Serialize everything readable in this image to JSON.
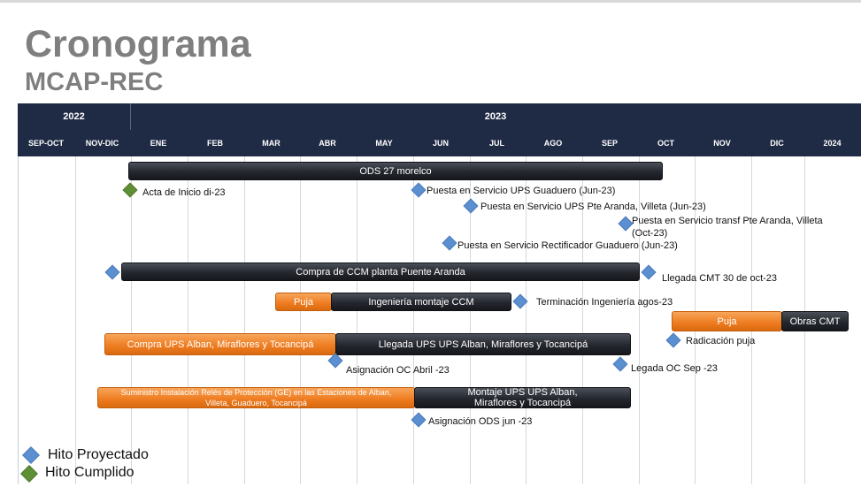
{
  "header": {
    "title": "Cronograma",
    "subtitle": "MCAP-REC"
  },
  "years": [
    "2022",
    "2023"
  ],
  "months": [
    "SEP-OCT",
    "NOV-DIC",
    "ENE",
    "FEB",
    "MAR",
    "ABR",
    "MAY",
    "JUN",
    "JUL",
    "AGO",
    "SEP",
    "OCT",
    "NOV",
    "DIC",
    "2024"
  ],
  "bars": {
    "ods": "ODS 27 morelco",
    "ccm": "Compra de CCM planta Puente Aranda",
    "puja1": "Puja",
    "ing_ccm": "Ingeniería montaje CCM",
    "puja2": "Puja",
    "obras": "Obras CMT",
    "compra_ups": "Compra UPS Alban, Miraflores y Tocancipá",
    "llegada_ups": "Llegada UPS UPS Alban, Miraflores y Tocancipá",
    "suministro": "Suministro Instalación Relés de Protección (GE) en las Estaciones de Alban, Villeta, Guaduero, Tocancipá",
    "montaje_ups": "Montaje UPS UPS Alban, Miraflores y Tocancipá"
  },
  "milestones": {
    "acta": "Acta de Inicio di-23",
    "ups_guaduero": "Puesta en Servicio UPS  Guaduero (Jun-23)",
    "ups_pte_aranda": "Puesta en Servicio UPS Pte Aranda, Villeta  (Jun-23)",
    "transf_pte_aranda": "Puesta en Servicio transf Pte Aranda, Villeta (Oct-23)",
    "rectificador": "Puesta en Servicio Rectificador Guaduero (Jun-23)",
    "llegada_cmt": "Llegada CMT 30 de oct-23",
    "terminacion_ing": "Terminación Ingeniería agos-23",
    "radicacion": "Radicación puja",
    "asignacion_oc": "Asignación OC Abril -23",
    "legada_oc": "Legada OC Sep -23",
    "asignacion_ods": "Asignación ODS jun -23"
  },
  "legend": {
    "projected": "Hito Proyectado",
    "completed": "Hito Cumplido"
  },
  "colors": {
    "header_bg": "#1f2b45",
    "bar_dark": "#24272e",
    "bar_orange": "#ee7b1f",
    "milestone_projected": "#5b8fd0",
    "milestone_completed": "#5e8f35"
  }
}
